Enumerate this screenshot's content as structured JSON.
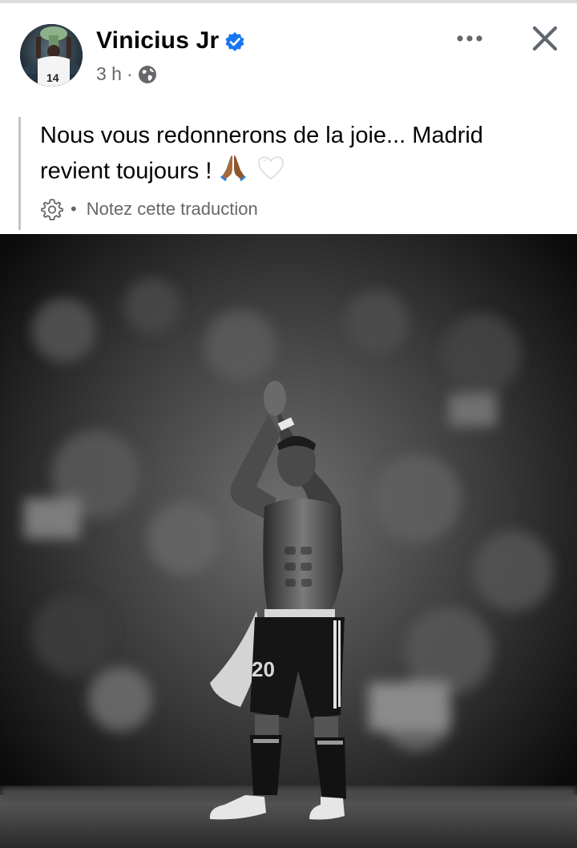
{
  "post": {
    "author": "Vinicius Jr",
    "verified": true,
    "time": "3 h",
    "separator": "·",
    "audience_icon": "globe-icon",
    "text_line1": "Nous vous redonnerons de la joie... Madrid",
    "text_line2": "revient toujours ! ",
    "emojis": [
      "folded-hands-emoji",
      "white-heart-emoji"
    ],
    "translation_separator": "•",
    "translation_rate": "Notez cette traduction",
    "translation_icon": "gear-icon",
    "avatar_jersey_number": "14",
    "photo_shorts_number": "20"
  },
  "colors": {
    "verified_blue": "#1877f2",
    "meta_grey": "#65676b",
    "text_black": "#050505"
  }
}
